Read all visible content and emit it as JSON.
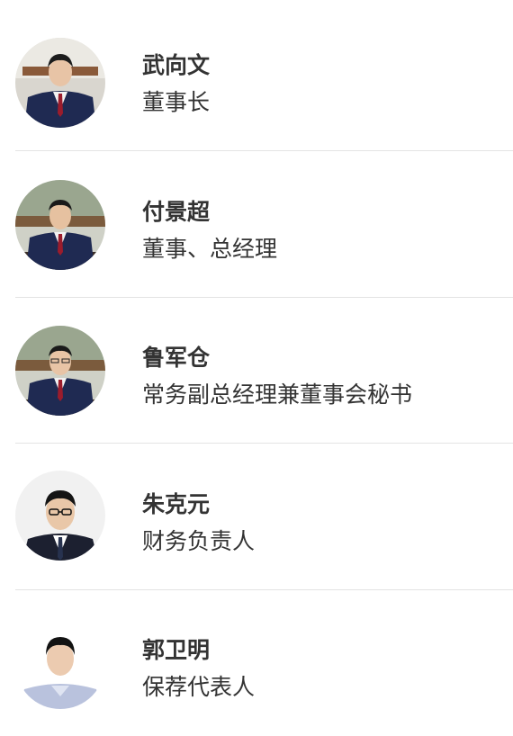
{
  "people": [
    {
      "name": "武向文",
      "title": "董事长",
      "avatar_icon": "person-photo-suit-office"
    },
    {
      "name": "付景超",
      "title": "董事、总经理",
      "avatar_icon": "person-photo-suit-office"
    },
    {
      "name": "鲁军仓",
      "title": "常务副总经理兼董事会秘书",
      "avatar_icon": "person-photo-suit-office"
    },
    {
      "name": "朱克元",
      "title": "财务负责人",
      "avatar_icon": "person-photo-suit-white-bg"
    },
    {
      "name": "郭卫明",
      "title": "保荐代表人",
      "avatar_icon": "person-photo-shirt-white-bg"
    }
  ],
  "colors": {
    "text": "#333333",
    "divider": "#e3e3e3",
    "suit": "#1f2a52",
    "tie": "#9b1c2c"
  }
}
